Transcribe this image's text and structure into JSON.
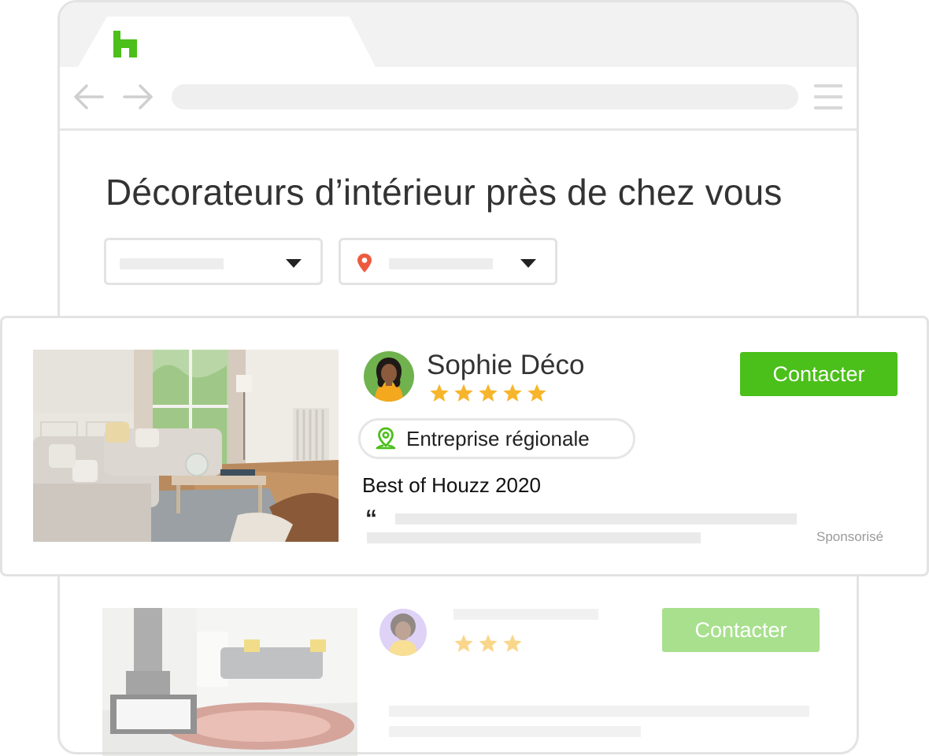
{
  "page": {
    "title": "Décorateurs d’intérieur près de chez vous"
  },
  "colors": {
    "brand_green": "#4bbf1a",
    "star_yellow": "#f7b52c",
    "pin_red": "#ee5a3e",
    "faded_button": "#a8e08e"
  },
  "icons": {
    "logo": "houzz-logo-icon",
    "back": "arrow-left-icon",
    "forward": "arrow-right-icon",
    "menu": "hamburger-menu-icon",
    "location": "map-pin-icon",
    "caret": "caret-down-icon",
    "regional": "location-pin-icon",
    "quote": "quote-icon"
  },
  "featured": {
    "name": "Sophie Déco",
    "rating": 5,
    "rating_max": 5,
    "contact_label": "Contacter",
    "badge_label": "Entreprise régionale",
    "award": "Best of Houzz 2020",
    "quote_mark": "“",
    "sponsored_label": "Sponsorisé"
  },
  "second": {
    "rating": 3,
    "contact_label": "Contacter"
  }
}
